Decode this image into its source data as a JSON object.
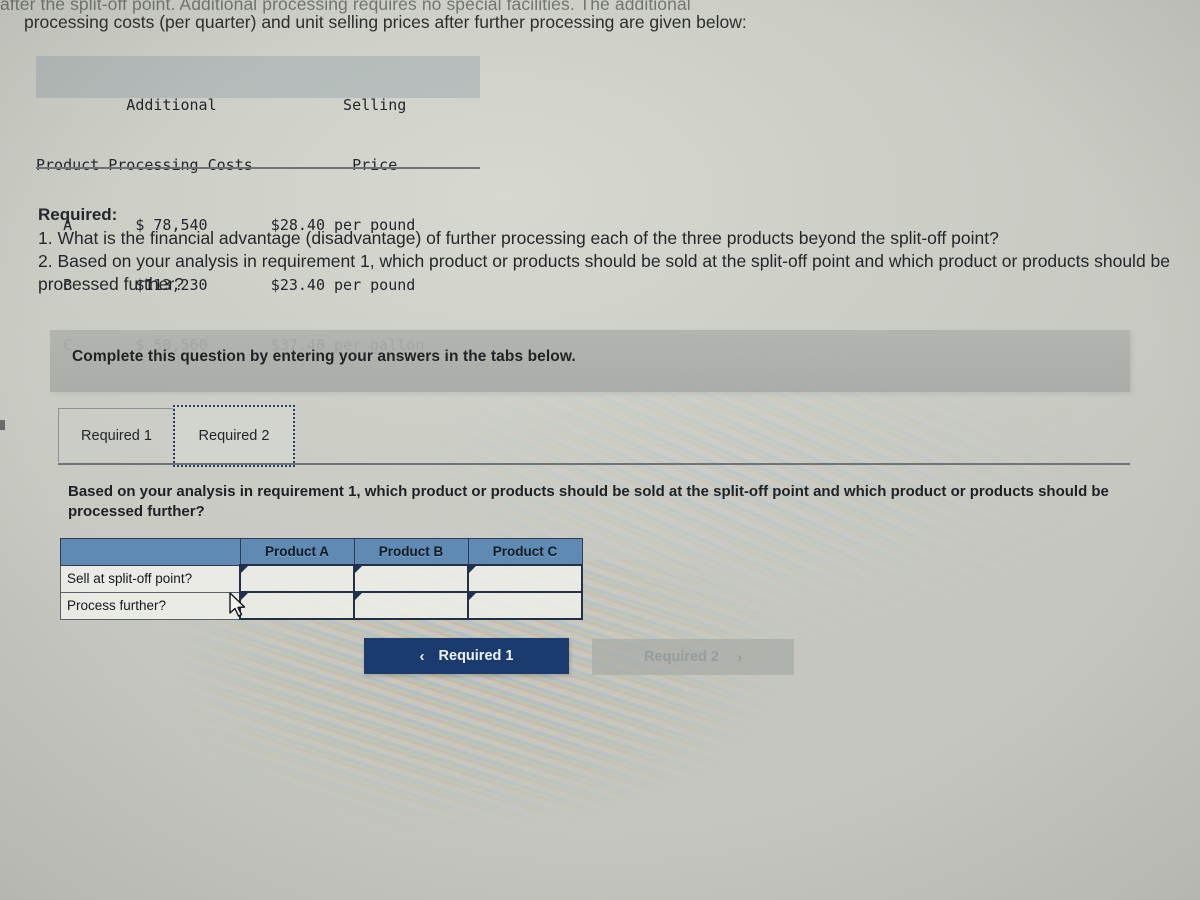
{
  "page": {
    "clipped_top_line": "after the split-off point. Additional processing requires no special facilities. The additional",
    "intro_line": "processing costs (per quarter) and unit selling prices after further processing are given below:"
  },
  "data_table": {
    "header_line_1": "          Additional              Selling",
    "header_line_2": "Product Processing Costs           Price",
    "columns": [
      "Product",
      "Additional Processing Costs",
      "Selling Price"
    ],
    "rows": [
      {
        "raw": "   A       $ 78,540       $28.40 per pound",
        "product": "A",
        "additional_processing_costs": "$ 78,540",
        "selling_price": "$28.40 per pound"
      },
      {
        "raw": "   B       $113,230       $23.40 per pound",
        "product": "B",
        "additional_processing_costs": "$113,230",
        "selling_price": "$23.40 per pound"
      },
      {
        "raw": "   C       $ 50,560       $37.40 per gallon",
        "product": "C",
        "additional_processing_costs": "$ 50,560",
        "selling_price": "$37.40 per gallon"
      }
    ]
  },
  "required": {
    "title": "Required:",
    "item_1": "1. What is the financial advantage (disadvantage) of further processing each of the three products beyond the split-off point?",
    "item_2": "2. Based on your analysis in requirement 1, which product or products should be sold at the split-off point and which product or products should be processed further?"
  },
  "banner": {
    "text": "Complete this question by entering your answers in the tabs below."
  },
  "tabs": {
    "items": [
      {
        "label": "Required 1",
        "active": false
      },
      {
        "label": "Required 2",
        "active": true
      }
    ]
  },
  "question": {
    "prompt": "Based on your analysis in requirement 1, which product or products should be sold at the split-off point and which product or products should be processed further?"
  },
  "answer_table": {
    "corner_header": "",
    "column_headers": [
      "Product A",
      "Product B",
      "Product C"
    ],
    "rows": [
      {
        "label": "Sell at split-off point?",
        "values": [
          "",
          "",
          ""
        ]
      },
      {
        "label": "Process further?",
        "values": [
          "",
          "",
          ""
        ]
      }
    ]
  },
  "navigation": {
    "prev_label": "Required 1",
    "prev_icon": "chevron-left",
    "prev_chevron": "‹",
    "next_label": "Required 2",
    "next_icon": "chevron-right",
    "next_chevron": "›",
    "next_disabled": true
  },
  "colors": {
    "table_header_blue": "#5f8ab4",
    "nav_button_navy": "#1b3a6d",
    "nav_button_disabled": "#a6aca6",
    "banner_gray": "#b0b2ae",
    "cell_marker_blue": "#1d3157",
    "page_background": "#c9cbc4"
  }
}
